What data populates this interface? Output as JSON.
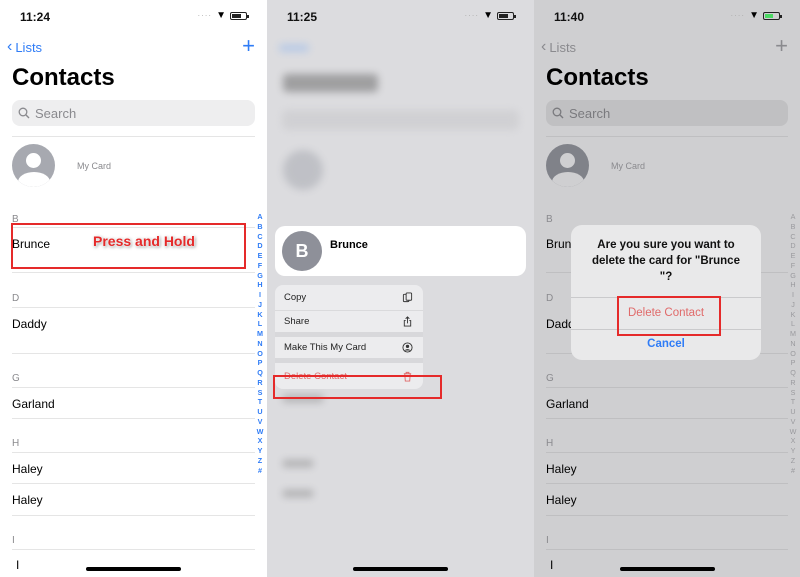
{
  "panels": [
    {
      "time": "11:24",
      "nav": {
        "back_label": "Lists",
        "add_icon": "plus-icon"
      },
      "title": "Contacts",
      "search": {
        "placeholder": "Search"
      },
      "my_card_label": "My Card",
      "sections": [
        {
          "letter": "B",
          "contacts": [
            "Brunce"
          ]
        },
        {
          "letter": "D",
          "contacts": [
            "Daddy"
          ]
        },
        {
          "letter": "G",
          "contacts": [
            "Garland"
          ]
        },
        {
          "letter": "H",
          "contacts": [
            "Haley",
            "Haley"
          ]
        },
        {
          "letter": "I",
          "contacts": [
            "I"
          ]
        }
      ],
      "annotation": "Press and Hold"
    },
    {
      "time": "11:25",
      "preview": {
        "initial": "B",
        "name": "Brunce"
      },
      "menu": [
        {
          "label": "Copy",
          "icon": "copy-icon"
        },
        {
          "label": "Share",
          "icon": "share-icon"
        },
        {
          "label": "Make This My Card",
          "icon": "person-circle-icon"
        },
        {
          "label": "Delete Contact",
          "icon": "trash-icon",
          "destructive": true
        }
      ]
    },
    {
      "time": "11:40",
      "nav": {
        "back_label": "Lists"
      },
      "title": "Contacts",
      "search": {
        "placeholder": "Search"
      },
      "my_card_label": "My Card",
      "sections": [
        {
          "letter": "B",
          "contacts": [
            "Brun"
          ]
        },
        {
          "letter": "D",
          "contacts": [
            "Dadd"
          ]
        },
        {
          "letter": "G",
          "contacts": [
            "Garland"
          ]
        },
        {
          "letter": "H",
          "contacts": [
            "Haley",
            "Haley"
          ]
        },
        {
          "letter": "I",
          "contacts": [
            "I"
          ]
        }
      ],
      "alert": {
        "message": "Are you sure you want to delete the card for \"Brunce \"?",
        "delete_label": "Delete Contact",
        "cancel_label": "Cancel"
      }
    }
  ],
  "index_letters": [
    "A",
    "B",
    "C",
    "D",
    "E",
    "F",
    "G",
    "H",
    "I",
    "J",
    "K",
    "L",
    "M",
    "N",
    "O",
    "P",
    "Q",
    "R",
    "S",
    "T",
    "U",
    "V",
    "W",
    "X",
    "Y",
    "Z",
    "#"
  ],
  "colors": {
    "accent": "#2f7cf6",
    "destructive": "#e06a6a",
    "annotation": "#e52a2a"
  }
}
